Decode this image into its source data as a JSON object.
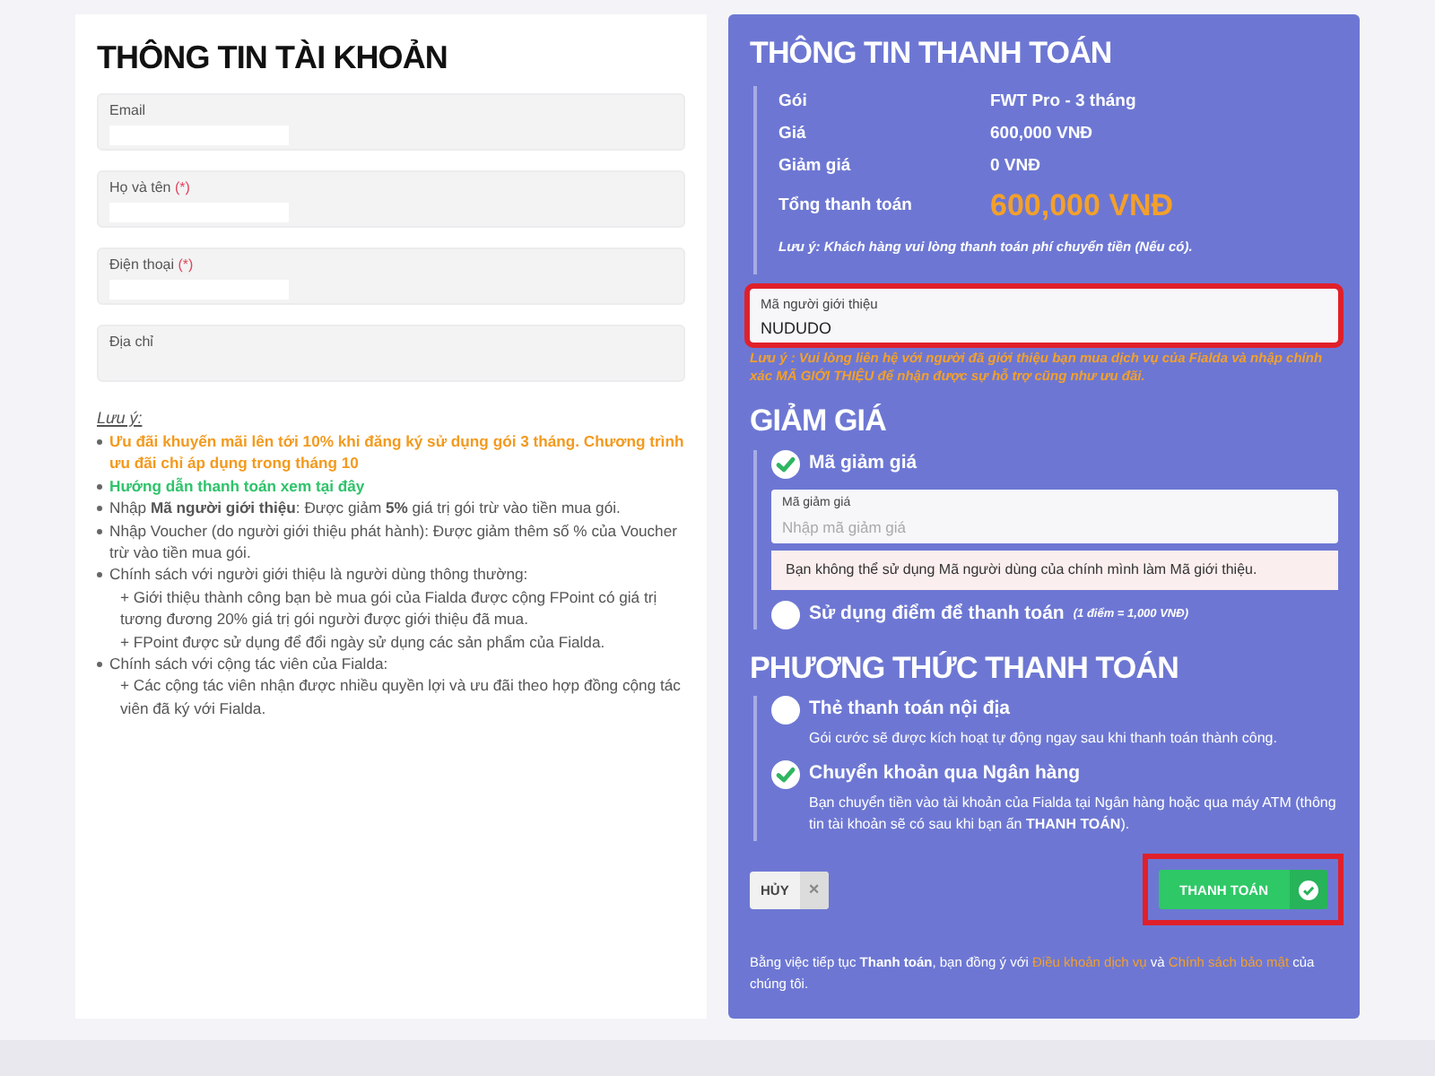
{
  "account": {
    "title": "THÔNG TIN TÀI KHOẢN",
    "fields": [
      {
        "label": "Email"
      },
      {
        "label": "Họ và tên",
        "required_mark": "(*)"
      },
      {
        "label": "Điện thoại",
        "required_mark": "(*)"
      },
      {
        "label": "Địa chỉ",
        "kind": "textarea"
      }
    ],
    "notes_title": "Lưu ý:",
    "notes": [
      {
        "kind": "promo",
        "text": "Ưu đãi khuyến mãi lên tới 10% khi đăng ký sử dụng gói 3 tháng. Chương trình ưu đãi chỉ áp dụng trong tháng 10"
      },
      {
        "kind": "guide",
        "text": "Hướng dẫn thanh toán xem tại đây"
      },
      {
        "kind": "plain",
        "text": "Nhập **Mã người giới thiệu**: Được giảm **5%** giá trị gói trừ vào tiền mua gói."
      },
      {
        "kind": "plain",
        "text": "Nhập Voucher (do người giới thiệu phát hành): Được giảm thêm số % của Voucher trừ vào tiền mua gói."
      },
      {
        "kind": "plain",
        "text": "Chính sách với người giới thiệu là người dùng thông thường:",
        "children": [
          {
            "text": "+  Giới thiệu thành công bạn bè mua gói của Fialda được cộng FPoint có giá trị tương đương 20% giá trị gói người được giới thiệu đã mua."
          },
          {
            "text": "+  FPoint được sử dụng để đổi ngày sử dụng các sản phẩm của Fialda."
          }
        ]
      },
      {
        "kind": "plain",
        "text": "Chính sách với cộng tác viên của Fialda:",
        "children": [
          {
            "text": "+  Các cộng tác viên nhận được nhiều quyền lợi và ưu đãi theo hợp đồng cộng tác viên đã ký với Fialda."
          }
        ]
      }
    ]
  },
  "payment": {
    "title": "THÔNG TIN THANH TOÁN",
    "rows": [
      {
        "label": "Gói",
        "value": "FWT Pro - 3 tháng",
        "kind": "plain"
      },
      {
        "label": "Giá",
        "value": "600,000 VNĐ",
        "kind": "plain"
      },
      {
        "label": "Giảm giá",
        "value": "0 VNĐ",
        "kind": "plain"
      },
      {
        "label": "Tổng thanh toán",
        "value": "600,000 VNĐ",
        "kind": "total"
      }
    ],
    "note": "Lưu ý: Khách hàng vui lòng thanh toán phí chuyển tiền (Nếu có).",
    "referral": {
      "label": "Mã người giới thiệu",
      "value": "NUDUDO",
      "highlighted": true
    },
    "referral_note": "Lưu ý : Vui lòng liên hệ với người đã giới thiệu bạn mua dịch vụ của Fialda và nhập chính xác MÃ GIỚI THIỆU để nhận được sự hỗ trợ cũng như ưu đãi."
  },
  "discount": {
    "title": "GIẢM GIÁ",
    "options": [
      {
        "kind": "code",
        "label": "Mã giảm giá",
        "selected": true,
        "field": {
          "label": "Mã giảm giá",
          "placeholder": "Nhập mã giảm giá"
        },
        "alert": "Bạn không thể sử dụng Mã người dùng của chính mình làm Mã giới thiệu."
      },
      {
        "kind": "points",
        "label": "Sử dụng điểm để thanh toán",
        "hint": "(1 điểm = 1,000 VNĐ)",
        "selected": false
      }
    ]
  },
  "methods": {
    "title": "PHƯƠNG THỨC THANH TOÁN",
    "options": [
      {
        "label": "Thẻ thanh toán nội địa",
        "description": "Gói cước sẽ được kích hoạt tự động ngay sau khi thanh toán thành công.",
        "selected": false
      },
      {
        "label": "Chuyển khoản qua Ngân hàng",
        "description": "Bạn chuyển tiền vào tài khoản của Fialda tại Ngân hàng hoặc qua máy ATM (thông tin tài khoản sẽ có sau khi bạn ấn **THANH TOÁN**).",
        "selected": true
      }
    ]
  },
  "cancel_button": {
    "label": "HỦY",
    "icon": "×"
  },
  "pay_button": {
    "label": "THANH TOÁN",
    "highlighted": true
  },
  "terms": [
    {
      "kind": "text",
      "text": "Bằng việc tiếp tục **Thanh toán**, bạn đồng ý với"
    },
    {
      "kind": "link",
      "text": "Điều khoản dịch vụ"
    },
    {
      "kind": "text",
      "text": "và"
    },
    {
      "kind": "link",
      "text": "Chính sách bảo mật"
    },
    {
      "kind": "text",
      "text": "của chúng tôi."
    }
  ]
}
